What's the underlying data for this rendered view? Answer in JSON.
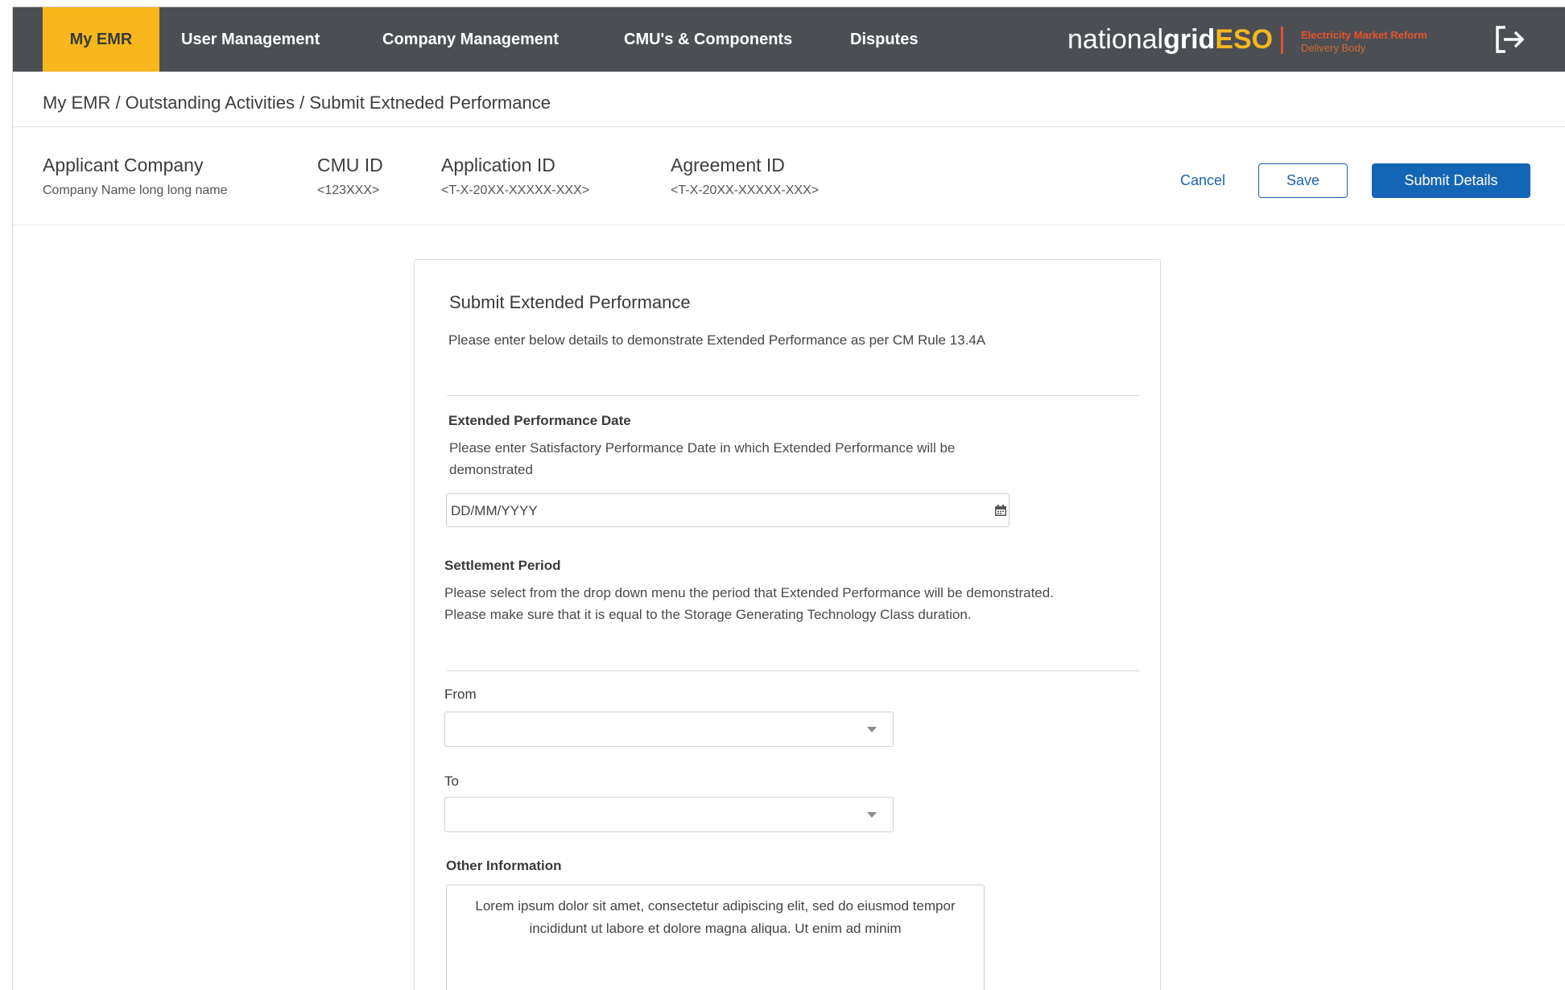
{
  "nav": {
    "items": [
      "My EMR",
      "User Management",
      "Company Management",
      "CMU's & Components",
      "Disputes"
    ],
    "active_index": 0,
    "logo": {
      "part1": "national",
      "part2": "grid",
      "part3": "ESO"
    },
    "logo_sub_line1": "Electricity Market Reform",
    "logo_sub_line2": "Delivery Body",
    "logout_icon": "logout-icon"
  },
  "breadcrumb": "My EMR / Outstanding Activities / Submit Extneded Performance",
  "header": {
    "applicant_company_label": "Applicant Company",
    "applicant_company_value": "Company Name long long name",
    "cmu_id_label": "CMU ID",
    "cmu_id_value": "<123XXX>",
    "application_id_label": "Application ID",
    "application_id_value": "<T-X-20XX-XXXXX-XXX>",
    "agreement_id_label": "Agreement ID",
    "agreement_id_value": "<T-X-20XX-XXXXX-XXX>",
    "cancel_label": "Cancel",
    "save_label": "Save",
    "submit_label": "Submit Details"
  },
  "form": {
    "title": "Submit Extended Performance",
    "intro": "Please enter below details to demonstrate Extended Performance as per CM Rule 13.4A",
    "date_section": {
      "title": "Extended Performance Date",
      "description": "Please enter Satisfactory Performance Date in which Extended Performance will be demonstrated",
      "placeholder": "DD/MM/YYYY",
      "icon": "calendar-icon"
    },
    "settlement_section": {
      "title": "Settlement Period",
      "description": "Please select from the drop down menu the period that Extended Performance will be demonstrated. Please make sure that it is equal to the Storage Generating Technology Class duration."
    },
    "from_label": "From",
    "from_value": "",
    "to_label": "To",
    "to_value": "",
    "other_info_label": "Other Information",
    "other_info_value": "Lorem ipsum dolor sit amet, consectetur adipiscing elit, sed do eiusmod tempor incididunt ut labore et dolore magna aliqua. Ut enim ad minim"
  },
  "colors": {
    "nav_bg": "#4b4f54",
    "nav_active": "#f7b71d",
    "primary": "#1565b7",
    "logo_accent": "#e8512a"
  }
}
